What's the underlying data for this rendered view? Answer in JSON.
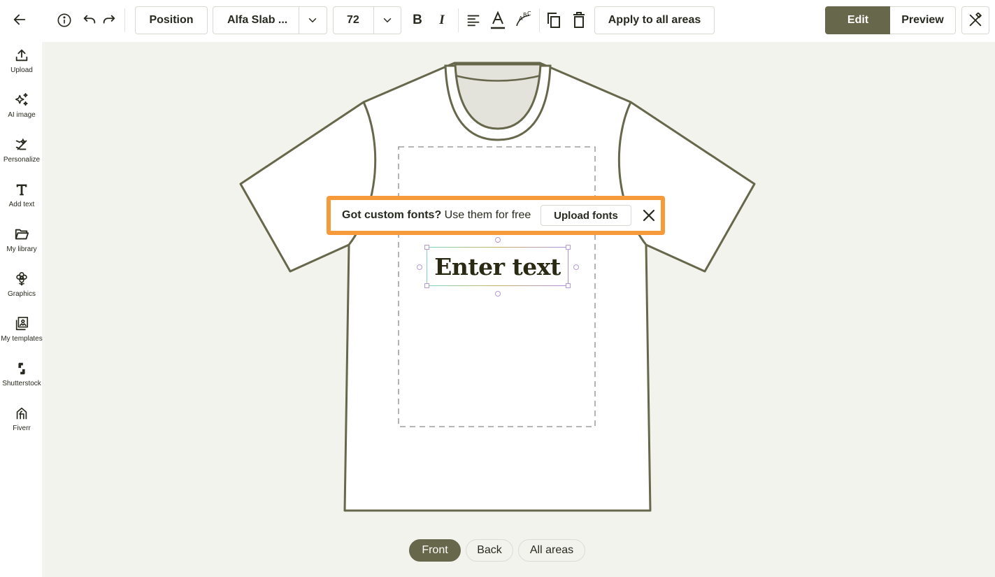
{
  "toolbar": {
    "back_icon": "arrow-left-icon",
    "info_icon": "info-icon",
    "undo_icon": "undo-icon",
    "redo_icon": "redo-icon",
    "position_label": "Position",
    "font_name": "Alfa Slab ...",
    "font_size": "72",
    "bold_icon": "bold-icon",
    "italic_icon": "italic-icon",
    "align_icon": "align-left-icon",
    "color_icon": "text-color-icon",
    "curve_icon": "curved-text-icon",
    "duplicate_icon": "duplicate-icon",
    "delete_icon": "trash-icon",
    "apply_label": "Apply to all areas",
    "edit_label": "Edit",
    "preview_label": "Preview",
    "tools_icon": "tools-icon"
  },
  "sidebar": {
    "items": [
      {
        "label": "Upload",
        "icon": "upload-icon"
      },
      {
        "label": "AI image",
        "icon": "sparkles-icon"
      },
      {
        "label": "Personalize",
        "icon": "personalize-icon"
      },
      {
        "label": "Add text",
        "icon": "text-icon"
      },
      {
        "label": "My library",
        "icon": "folder-icon"
      },
      {
        "label": "Graphics",
        "icon": "flower-icon"
      },
      {
        "label": "My templates",
        "icon": "templates-icon"
      },
      {
        "label": "Shutterstock",
        "icon": "shutterstock-icon"
      },
      {
        "label": "Fiverr",
        "icon": "fiverr-icon"
      }
    ]
  },
  "banner": {
    "bold_text": "Got custom fonts?",
    "text": " Use them for free",
    "button_label": "Upload fonts",
    "close_icon": "close-icon",
    "border_color": "#f79a3a"
  },
  "design": {
    "text": "Enter text"
  },
  "views": {
    "tabs": [
      "Front",
      "Back",
      "All areas"
    ],
    "active": "Front"
  },
  "colors": {
    "accent": "#67674c",
    "canvas_bg": "#f3f3ee",
    "shirt_outline": "#67674c"
  }
}
